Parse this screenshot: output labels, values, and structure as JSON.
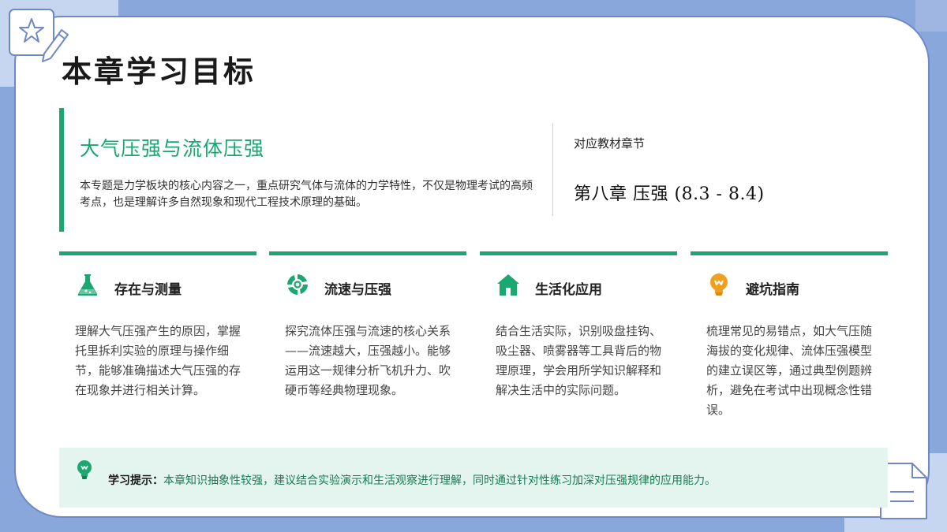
{
  "slide": {
    "title": "本章学习目标"
  },
  "topic": {
    "title": "大气压强与流体压强",
    "description": "本专题是力学板块的核心内容之一，重点研究气体与流体的力学特性，不仅是物理考试的高频考点，也是理解许多自然现象和现代工程技术原理的基础。"
  },
  "chapter": {
    "label": "对应教材章节",
    "value": "第八章 压强 (8.3 - 8.4)"
  },
  "objectives": [
    {
      "icon": "flask-icon",
      "title": "存在与测量",
      "body": "理解大气压强产生的原因，掌握托里拆利实验的原理与操作细节，能够准确描述大气压强的存在现象并进行相关计算。"
    },
    {
      "icon": "swirl-icon",
      "title": "流速与压强",
      "body": "探究流体压强与流速的核心关系——流速越大，压强越小。能够运用这一规律分析飞机升力、吹硬币等经典物理现象。"
    },
    {
      "icon": "house-icon",
      "title": "生活化应用",
      "body": "结合生活实际，识别吸盘挂钩、吸尘器、喷雾器等工具背后的物理原理，学会用所学知识解释和解决生活中的实际问题。"
    },
    {
      "icon": "lightbulb-icon",
      "title": "避坑指南",
      "body": "梳理常见的易错点，如大气压随海拔的变化规律、流体压强模型的建立误区等，通过典型例题辨析，避免在考试中出现概念性错误。"
    }
  ],
  "tip": {
    "label": "学习提示：",
    "text": "本章知识抽象性较强，建议结合实验演示和生活观察进行理解，同时通过针对性练习加深对压强规律的应用能力。"
  },
  "colors": {
    "accent": "#1aa770",
    "frame": "#8aa7dc",
    "tip_bg": "#e3f5ee",
    "bulb": "#f0a020"
  }
}
